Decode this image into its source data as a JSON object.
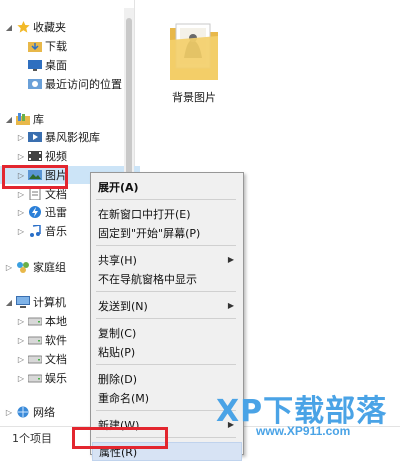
{
  "nav": {
    "items": [
      {
        "label": "收藏夹",
        "icon": "star-icon",
        "expand": "expanded"
      },
      {
        "label": "下载",
        "icon": "download-folder-icon",
        "expand": ""
      },
      {
        "label": "桌面",
        "icon": "desktop-icon",
        "expand": ""
      },
      {
        "label": "最近访问的位置",
        "icon": "recent-places-icon",
        "expand": ""
      },
      {
        "label": "库",
        "icon": "library-icon",
        "expand": "expanded"
      },
      {
        "label": "暴风影视库",
        "icon": "video-library-icon",
        "expand": "collapsed"
      },
      {
        "label": "视频",
        "icon": "video-icon",
        "expand": "collapsed"
      },
      {
        "label": "图片",
        "icon": "pictures-icon",
        "expand": "collapsed",
        "selected": true
      },
      {
        "label": "文档",
        "icon": "documents-icon",
        "expand": "collapsed"
      },
      {
        "label": "迅雷",
        "icon": "thunder-icon",
        "expand": "collapsed"
      },
      {
        "label": "音乐",
        "icon": "music-icon",
        "expand": "collapsed"
      },
      {
        "label": "家庭组",
        "icon": "homegroup-icon",
        "expand": "collapsed"
      },
      {
        "label": "计算机",
        "icon": "computer-icon",
        "expand": "expanded"
      },
      {
        "label": "本地",
        "icon": "drive-icon",
        "expand": "collapsed"
      },
      {
        "label": "软件",
        "icon": "drive-icon",
        "expand": "collapsed"
      },
      {
        "label": "文档",
        "icon": "drive-icon",
        "expand": "collapsed"
      },
      {
        "label": "娱乐",
        "icon": "drive-icon",
        "expand": "collapsed"
      },
      {
        "label": "网络",
        "icon": "network-icon",
        "expand": "collapsed"
      }
    ]
  },
  "content": {
    "folder_label": "背景图片"
  },
  "status": {
    "text": "1个项目"
  },
  "context_menu": {
    "items": [
      {
        "label": "展开(A)",
        "bold": true
      },
      {
        "separator": true
      },
      {
        "label": "在新窗口中打开(E)"
      },
      {
        "label": "固定到\"开始\"屏幕(P)"
      },
      {
        "separator": true
      },
      {
        "label": "共享(H)",
        "submenu": true
      },
      {
        "label": "不在导航窗格中显示"
      },
      {
        "separator": true
      },
      {
        "label": "发送到(N)",
        "submenu": true
      },
      {
        "separator": true
      },
      {
        "label": "复制(C)"
      },
      {
        "label": "粘贴(P)"
      },
      {
        "separator": true
      },
      {
        "label": "删除(D)"
      },
      {
        "label": "重命名(M)"
      },
      {
        "separator": true
      },
      {
        "label": "新建(W)",
        "submenu": true
      },
      {
        "separator": true
      },
      {
        "label": "属性(R)",
        "highlighted": true
      }
    ]
  },
  "watermark": {
    "title": "XP下载部落",
    "url": "www.XP911.com"
  },
  "colors": {
    "highlight_box": "#e3262f",
    "selection": "#cce4f7",
    "watermark": "#4aa3e6"
  }
}
